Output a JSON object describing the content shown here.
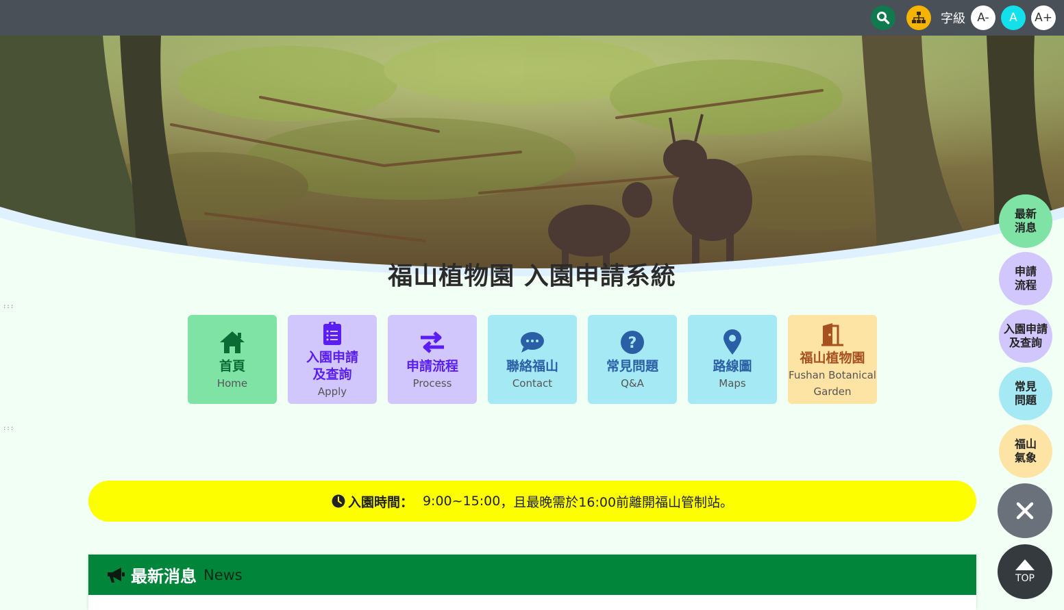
{
  "access_keys": [
    ":::",
    ":::",
    ":::"
  ],
  "header": {
    "search_icon": "search-icon",
    "sitemap_icon": "sitemap-icon",
    "font_size_label": "字級",
    "font_small": "A-",
    "font_normal": "A",
    "font_large": "A+"
  },
  "hero": {
    "title": "福山植物園 入園申請系統"
  },
  "menu": [
    {
      "zh": "首頁",
      "en": "Home",
      "icon": "home-icon"
    },
    {
      "zh": "入園申請\n及查詢",
      "en": "Apply",
      "icon": "clipboard-list-icon"
    },
    {
      "zh": "申請流程",
      "en": "Process",
      "icon": "exchange-arrows-icon"
    },
    {
      "zh": "聯絡福山",
      "en": "Contact",
      "icon": "chat-bubble-icon"
    },
    {
      "zh": "常見問題",
      "en": "Q&A",
      "icon": "question-circle-icon"
    },
    {
      "zh": "路線圖",
      "en": "Maps",
      "icon": "map-pin-icon"
    },
    {
      "zh": "福山植物園",
      "en": "Fushan Botanical Garden",
      "icon": "door-open-icon"
    }
  ],
  "notice": {
    "icon": "clock-icon",
    "label": "入園時間：",
    "hours": "9:00~15:00",
    "text": "，且最晚需於16:00前離開福山管制站。"
  },
  "news": {
    "icon": "megaphone-icon",
    "title_zh": "最新消息",
    "title_en": "News"
  },
  "side_menu": [
    {
      "label": "最新\n消息"
    },
    {
      "label": "申請\n流程"
    },
    {
      "label": "入園申請\n及查詢"
    },
    {
      "label": "常見\n問題"
    },
    {
      "label": "福山\n氣象"
    }
  ],
  "side_close_icon": "close-icon",
  "side_top": {
    "label": "TOP",
    "icon": "chevron-up-icon"
  },
  "colors": {
    "topbar": "#4a5058",
    "page_bg": "#f2fff4",
    "tile_green": "#7fe3a6",
    "tile_purple": "#d2c7fd",
    "tile_cyan": "#a5e9f4",
    "tile_orange": "#fde3a4",
    "notice": "#fdff00",
    "news_header": "#00853a"
  }
}
